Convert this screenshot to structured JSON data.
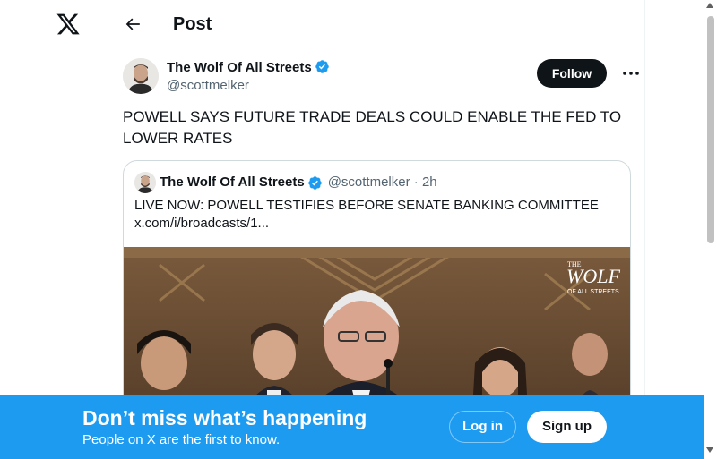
{
  "header": {
    "title": "Post"
  },
  "post": {
    "author_name": "The Wolf Of All Streets",
    "author_handle": "@scottmelker",
    "follow_label": "Follow",
    "text": "POWELL SAYS FUTURE TRADE DEALS COULD ENABLE THE FED TO LOWER RATES"
  },
  "quote": {
    "author_name": "The Wolf Of All Streets",
    "author_handle": "@scottmelker",
    "separator": "·",
    "time": "2h",
    "text_line1": "LIVE NOW: POWELL TESTIFIES BEFORE SENATE BANKING COMMITTEE",
    "text_line2": "x.com/i/broadcasts/1...",
    "watermark_top": "THE",
    "watermark_main": "WOLF",
    "watermark_bottom": "OF ALL STREETS"
  },
  "banner": {
    "title": "Don’t miss what’s happening",
    "subtitle": "People on X are the first to know.",
    "login_label": "Log in",
    "signup_label": "Sign up"
  },
  "colors": {
    "accent": "#1d9bf0",
    "text": "#0f1419",
    "secondary": "#536471",
    "border": "#cfd9de"
  },
  "icons": [
    "x-logo-icon",
    "back-arrow-icon",
    "verified-badge-icon",
    "more-icon"
  ]
}
